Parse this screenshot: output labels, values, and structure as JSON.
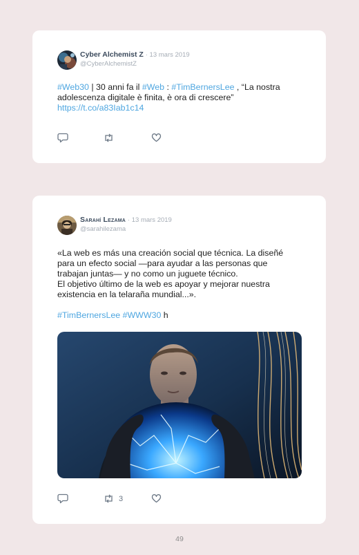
{
  "tweets": [
    {
      "name": "Cyber Alchemist Z",
      "date": "13 mars 2019",
      "handle": "@CyberAlchemistZ",
      "body": {
        "l1_tag1": "#Web30",
        "l1_t1": " | 30 anni fa il ",
        "l1_tag2": "#Web",
        "l1_t2": " : ",
        "l1_tag3": "#TimBernersLee",
        "l1_t3": " , “La nostra",
        "l2": "adolescenza digitale è finita, è ora di crescere”",
        "link": "https://t.co/a83Iab1c14"
      },
      "actions": {
        "retweet_count": "",
        "like_count": ""
      }
    },
    {
      "name": "Sarahí Lezama",
      "date": "13 mars 2019",
      "handle": "@sarahilezama",
      "body": {
        "l1": "«La web es más una creación social que técnica. La diseñé",
        "l2": "para un efecto social —para ayudar a las personas que",
        "l3": "trabajan juntas— y no como un juguete técnico.",
        "l4": "El objetivo último de la web es apoyar y mejorar nuestra",
        "l5": "existencia en la telaraña mundial...».",
        "tag1": "#TimBernersLee",
        "tag2": "#WWW30",
        "tail": " h"
      },
      "actions": {
        "retweet_count": "3",
        "like_count": ""
      }
    }
  ],
  "icons": {
    "reply": "speech-bubble-icon",
    "retweet": "retweet-arrows-icon",
    "like": "heart-icon"
  },
  "colors": {
    "page_background": "#f1e7e8",
    "card": "#ffffff",
    "hashtag": "#4ea6e0",
    "muted": "#a6adb6",
    "name": "#3b4a5c"
  },
  "page_number": "49"
}
